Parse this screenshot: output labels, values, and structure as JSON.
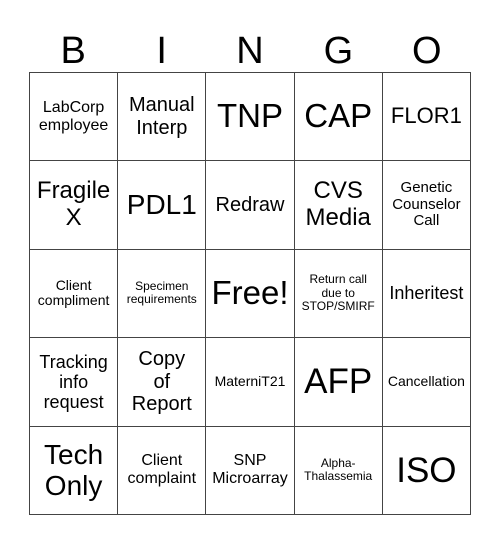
{
  "header": [
    "B",
    "I",
    "N",
    "G",
    "O"
  ],
  "cells": [
    [
      "LabCorp\nemployee",
      "Manual\nInterp",
      "TNP",
      "CAP",
      "FLOR1"
    ],
    [
      "Fragile\nX",
      "PDL1",
      "Redraw",
      "CVS\nMedia",
      "Genetic\nCounselor\nCall"
    ],
    [
      "Client\ncompliment",
      "Specimen\nrequirements",
      "Free!",
      "Return call\ndue to\nSTOP/SMIRF",
      "Inheritest"
    ],
    [
      "Tracking\ninfo\nrequest",
      "Copy\nof\nReport",
      "MaterniT21",
      "AFP",
      "Cancellation"
    ],
    [
      "Tech\nOnly",
      "Client\ncomplaint",
      "SNP\nMicroarray",
      "Alpha-\nThalassemia",
      "ISO"
    ]
  ]
}
